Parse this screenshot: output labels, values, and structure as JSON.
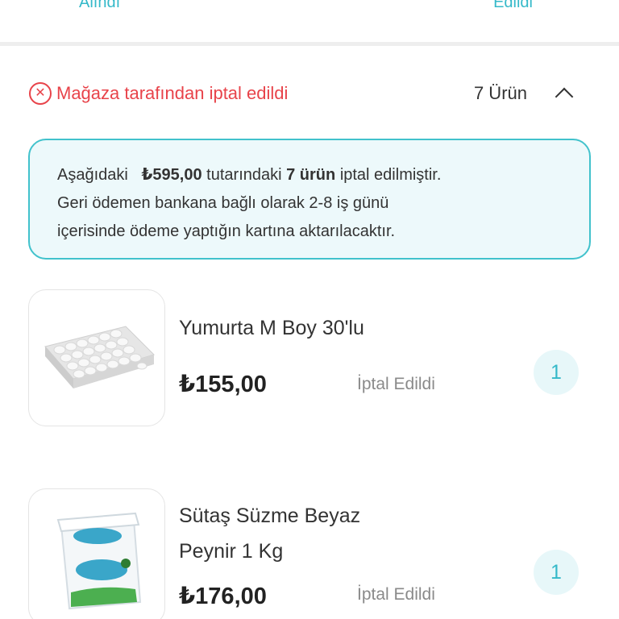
{
  "header": {
    "left_step": "Alındı",
    "right_step": "Edildi"
  },
  "cancel_section": {
    "status": "Mağaza tarafından iptal edildi",
    "count": "7 Ürün"
  },
  "info": {
    "line1_prefix": "Aşağıdaki",
    "amount": "₺595,00",
    "line1_mid": "tutarındaki",
    "items_count": "7 ürün",
    "line1_suffix": "iptal edilmiştir.",
    "line2": "Geri ödemen bankana bağlı olarak 2-8 iş günü",
    "line3": "içerisinde ödeme yaptığın kartına aktarılacaktır."
  },
  "products": [
    {
      "name": "Yumurta M Boy 30'lu",
      "price": "₺155,00",
      "status": "İptal Edildi",
      "quantity": "1"
    },
    {
      "name_line1": "Sütaş Süzme Beyaz",
      "name_line2": "Peynir 1 Kg",
      "price": "₺176,00",
      "status": "İptal Edildi",
      "quantity": "1"
    }
  ],
  "colors": {
    "accent": "#35b9c9",
    "cancel_red": "#e8434a",
    "info_bg": "#edf9fb"
  }
}
